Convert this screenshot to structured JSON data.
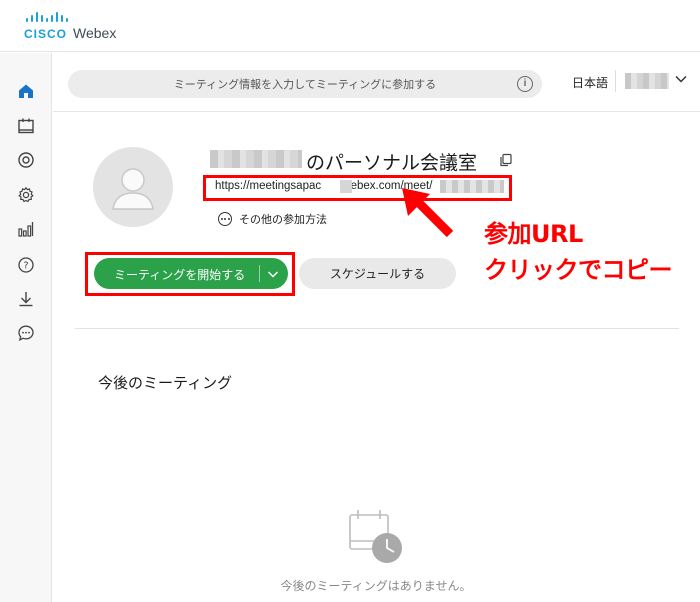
{
  "header": {
    "brand_cisco": "CISCO",
    "brand_webex": "Webex"
  },
  "sidenav": {
    "items": [
      {
        "icon": "home-icon",
        "active": true
      },
      {
        "icon": "calendar-icon"
      },
      {
        "icon": "record-icon"
      },
      {
        "icon": "gear-icon"
      },
      {
        "icon": "bar-chart-icon"
      },
      {
        "icon": "help-icon"
      },
      {
        "icon": "download-icon"
      },
      {
        "icon": "chat-bubble-icon"
      }
    ],
    "accent": "#1a73c7"
  },
  "search": {
    "placeholder": "ミーティング情報を入力してミーティングに参加する"
  },
  "language": "日本語",
  "room": {
    "name_suffix": "のパーソナル会議室",
    "url_prefix": "https://meetingsapac",
    "url_mid": ".webex.com/meet/",
    "other_join_label": "その他の参加方法"
  },
  "actions": {
    "start_label": "ミーティングを開始する",
    "schedule_label": "スケジュールする",
    "start_color": "#2ba14a"
  },
  "annotation": {
    "line1": "参加URL",
    "line2": "クリックでコピー",
    "color": "#ff0000"
  },
  "upcoming": {
    "title": "今後のミーティング",
    "empty_message": "今後のミーティングはありません。"
  }
}
